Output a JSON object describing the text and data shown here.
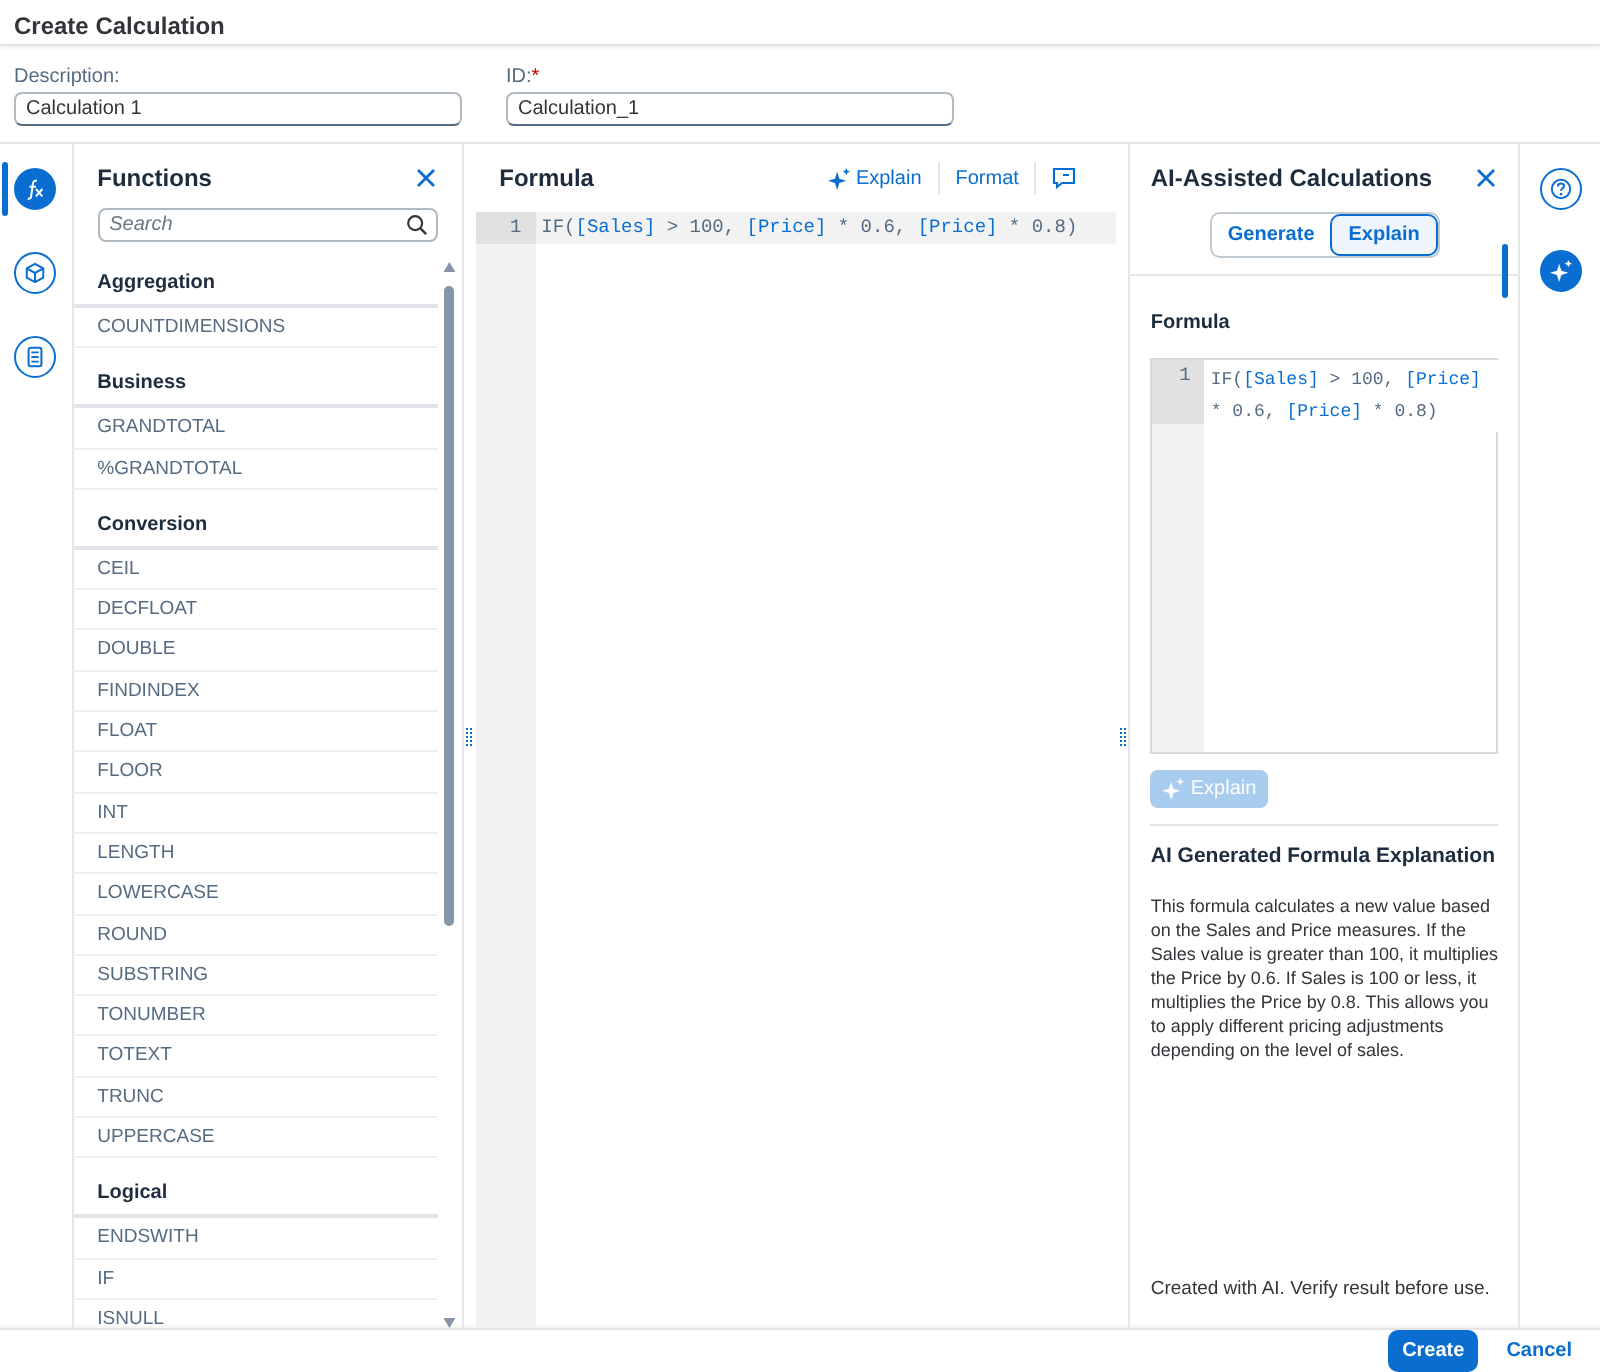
{
  "window": {
    "title": "Create Calculation"
  },
  "fields": [
    {
      "label": "Description:",
      "value": "Calculation 1"
    },
    {
      "label": "ID:",
      "required_mark": "*",
      "value": "Calculation_1"
    }
  ],
  "left_rail": [
    {
      "kind": "function",
      "selected": true
    },
    {
      "kind": "cube",
      "selected": false
    },
    {
      "kind": "calculator",
      "selected": false
    }
  ],
  "functions_panel": {
    "title": "Functions",
    "search": {
      "placeholder": "Search"
    },
    "groups": [
      {
        "name": "Aggregation",
        "items": [
          "COUNTDIMENSIONS"
        ]
      },
      {
        "name": "Business",
        "items": [
          "GRANDTOTAL",
          "%GRANDTOTAL"
        ]
      },
      {
        "name": "Conversion",
        "items": [
          "CEIL",
          "DECFLOAT",
          "DOUBLE",
          "FINDINDEX",
          "FLOAT",
          "FLOOR",
          "INT",
          "LENGTH",
          "LOWERCASE",
          "ROUND",
          "SUBSTRING",
          "TONUMBER",
          "TOTEXT",
          "TRUNC",
          "UPPERCASE"
        ]
      },
      {
        "name": "Logical",
        "items": [
          "ENDSWITH",
          "IF",
          "ISNULL"
        ]
      }
    ]
  },
  "formula_panel": {
    "title": "Formula",
    "actions": [
      {
        "kind": "explain",
        "label": "Explain"
      },
      {
        "kind": "format",
        "label": "Format"
      },
      {
        "kind": "comment"
      }
    ],
    "lines": [
      {
        "number": "1",
        "tokens": [
          {
            "kind": "fn",
            "text": "IF("
          },
          {
            "kind": "field",
            "text": "[Sales]"
          },
          {
            "kind": "op",
            "text": " > 100, "
          },
          {
            "kind": "field",
            "text": "[Price]"
          },
          {
            "kind": "op",
            "text": " * 0.6, "
          },
          {
            "kind": "field",
            "text": "[Price]"
          },
          {
            "kind": "op",
            "text": " * 0.8)"
          }
        ]
      }
    ]
  },
  "ai_panel": {
    "title": "AI-Assisted Calculations",
    "modes": [
      {
        "label": "Generate",
        "selected": false
      },
      {
        "label": "Explain",
        "selected": true
      }
    ],
    "formula_label": "Formula",
    "lines": [
      {
        "number": "1",
        "tokens": [
          {
            "kind": "fn",
            "text": "IF("
          },
          {
            "kind": "field",
            "text": "[Sales]"
          },
          {
            "kind": "op",
            "text": " > 100, "
          },
          {
            "kind": "field",
            "text": "[Price]"
          },
          {
            "kind": "op",
            "text": " * 0.6, "
          },
          {
            "kind": "field",
            "text": "[Price]"
          },
          {
            "kind": "op",
            "text": " * 0.8)"
          }
        ]
      }
    ],
    "explain_button": {
      "label": "Explain",
      "disabled": true
    },
    "explanation_title": "AI Generated Formula Explanation",
    "explanation": "This formula calculates a new value based on the Sales and Price measures. If the Sales value is greater than 100, it multiplies the Price by 0.6. If Sales is 100 or less, it multiplies the Price by 0.8. This allows you to apply different pricing adjustments depending on the level of sales.",
    "disclaimer": "Created with AI. Verify result before use."
  },
  "right_rail": [
    {
      "kind": "help",
      "selected": false
    },
    {
      "kind": "ai",
      "selected": true
    }
  ],
  "footer": {
    "buttons": [
      {
        "kind": "primary",
        "label": "Create"
      },
      {
        "kind": "link",
        "label": "Cancel"
      }
    ]
  }
}
